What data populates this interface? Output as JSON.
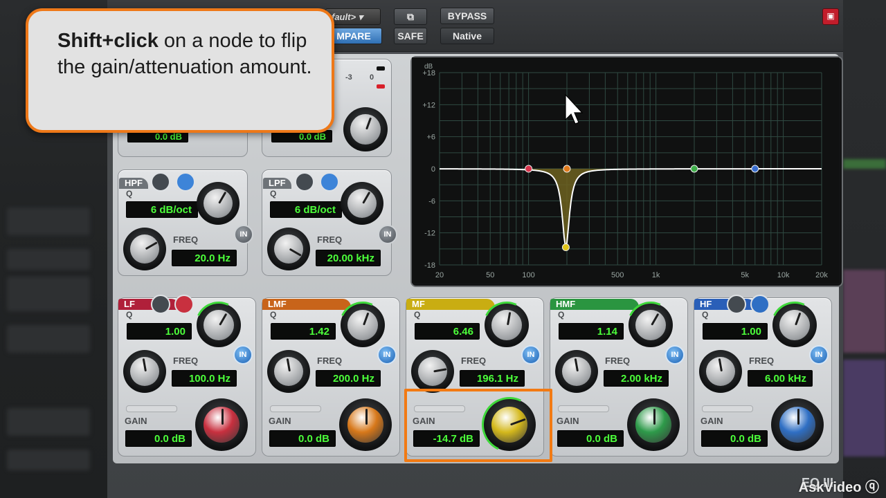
{
  "header": {
    "preset_label": "fault>",
    "compare_label": "MPARE",
    "safe_label": "SAFE",
    "bypass_label": "BYPASS",
    "native_label": "Native"
  },
  "callout": {
    "bold_text": "Shift+click",
    "rest_text": " on a node to flip the gain/attenuation amount."
  },
  "top_panel": {
    "meter_labels": [
      "-3",
      "0"
    ],
    "left_value": "0.0 dB",
    "right_value": "0.0 dB"
  },
  "filters": [
    {
      "name": "HPF",
      "q_label": "Q",
      "slope": "6 dB/oct",
      "freq_label": "FREQ",
      "freq": "20.0 Hz",
      "in_label": "IN"
    },
    {
      "name": "LPF",
      "q_label": "Q",
      "slope": "6 dB/oct",
      "freq_label": "FREQ",
      "freq": "20.00 kHz",
      "in_label": "IN"
    }
  ],
  "bands": [
    {
      "name": "LF",
      "q": "1.00",
      "freq": "100.0 Hz",
      "gain": "0.0 dB",
      "color": "#c8303f",
      "tab_color": "#b0203a",
      "q_label": "Q",
      "freq_label": "FREQ",
      "gain_label": "GAIN",
      "in_label": "IN"
    },
    {
      "name": "LMF",
      "q": "1.42",
      "freq": "200.0 Hz",
      "gain": "0.0 dB",
      "color": "#d7781a",
      "tab_color": "#c8641a",
      "q_label": "Q",
      "freq_label": "FREQ",
      "gain_label": "GAIN",
      "in_label": "IN"
    },
    {
      "name": "MF",
      "q": "6.46",
      "freq": "196.1 Hz",
      "gain": "-14.7 dB",
      "color": "#d4b81c",
      "tab_color": "#c9ad12",
      "q_label": "Q",
      "freq_label": "FREQ",
      "gain_label": "GAIN",
      "in_label": "IN"
    },
    {
      "name": "HMF",
      "q": "1.14",
      "freq": "2.00 kHz",
      "gain": "0.0 dB",
      "color": "#2e9a4a",
      "tab_color": "#2a9540",
      "q_label": "Q",
      "freq_label": "FREQ",
      "gain_label": "GAIN",
      "in_label": "IN"
    },
    {
      "name": "HF",
      "q": "1.00",
      "freq": "6.00 kHz",
      "gain": "0.0 dB",
      "color": "#2f6fc4",
      "tab_color": "#2a5fb8",
      "q_label": "Q",
      "freq_label": "FREQ",
      "gain_label": "GAIN",
      "in_label": "IN"
    }
  ],
  "graph": {
    "db_label": "dB",
    "y_ticks": [
      "+18",
      "+12",
      "+6",
      "0",
      "-6",
      "-12",
      "-18"
    ],
    "x_ticks": [
      "20",
      "50",
      "100",
      "500",
      "1k",
      "5k",
      "10k",
      "20k"
    ],
    "nodes": [
      {
        "name": "LF",
        "color": "#d8344c"
      },
      {
        "name": "LMF",
        "color": "#e07a1c"
      },
      {
        "name": "MF",
        "color": "#e0c41a"
      },
      {
        "name": "HMF",
        "color": "#3fae4a"
      },
      {
        "name": "HF",
        "color": "#3a6fd0"
      }
    ],
    "colors": {
      "curve": "#ffffff",
      "fill": "#6d6220",
      "grid": "#2f4a42"
    }
  },
  "footer": {
    "plugin_name": "EQ III",
    "watermark": "AskVideo"
  }
}
